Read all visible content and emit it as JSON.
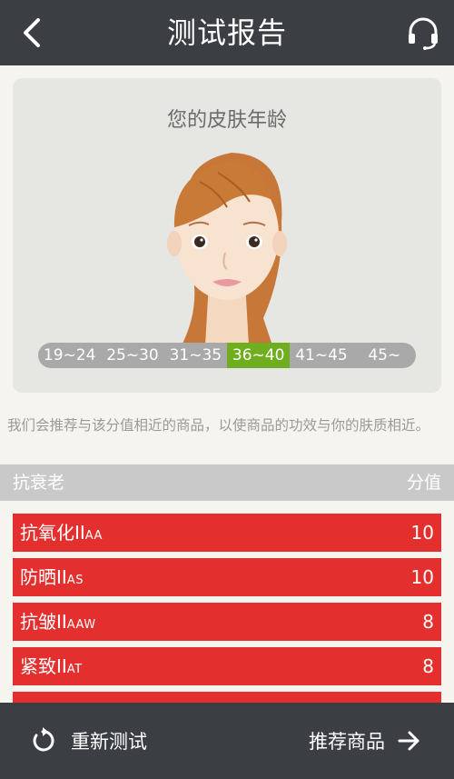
{
  "header": {
    "title": "测试报告",
    "back_icon": "chevron-left-icon",
    "support_icon": "headset-icon"
  },
  "skin_age": {
    "title": "您的皮肤年龄",
    "ranges": [
      "19~24",
      "25~30",
      "31~35",
      "36~40",
      "41~45",
      "45~"
    ],
    "selected": "36~40",
    "selected_color": "#6fae1f"
  },
  "note": "我们会推荐与该分值相近的商品，以使商品的功效与你的肤质相近。",
  "section": {
    "title": "抗衰老",
    "score_label": "分值"
  },
  "rows": [
    {
      "name": "抗氧化II",
      "code": "AA",
      "score": "10"
    },
    {
      "name": "防晒II",
      "code": "AS",
      "score": "10"
    },
    {
      "name": "抗皱II",
      "code": "AAW",
      "score": "8"
    },
    {
      "name": "紧致II",
      "code": "AT",
      "score": "8"
    }
  ],
  "footer": {
    "retest_label": "重新测试",
    "recommend_label": "推荐商品",
    "retest_icon": "refresh-icon",
    "recommend_icon": "arrow-right-icon"
  },
  "colors": {
    "topbar": "#3b3f44",
    "row_red": "#e3302f",
    "active_green": "#6fae1f"
  }
}
